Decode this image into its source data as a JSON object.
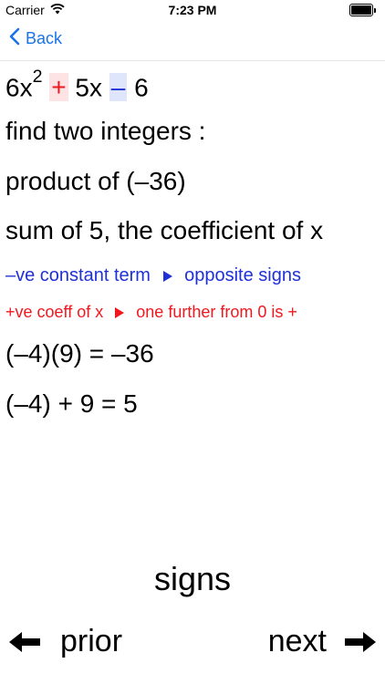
{
  "status": {
    "carrier": "Carrier",
    "time": "7:23 PM"
  },
  "nav": {
    "back_label": "Back"
  },
  "content": {
    "eq": {
      "coef": "6x",
      "exp": "2",
      "plus": "+",
      "mid": "5x",
      "minus": "–",
      "end": "6"
    },
    "find": "find two integers :",
    "product": "product of (–36)",
    "sum": "sum of 5, the coefficient of x",
    "blue_left": "–ve constant term",
    "blue_right": "opposite signs",
    "red_left": "+ve coeff of x",
    "red_right": "one further from 0 is +",
    "mult": "(–4)(9) = –36",
    "add": "(–4) + 9 = 5"
  },
  "controls": {
    "title": "signs",
    "prior": "prior",
    "next": "next"
  }
}
